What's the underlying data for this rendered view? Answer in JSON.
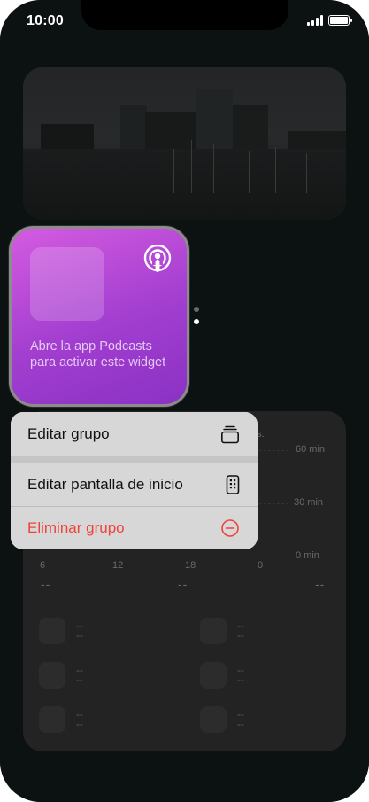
{
  "status_bar": {
    "time": "10:00"
  },
  "podcast_widget": {
    "message": "Abre la app Podcasts para activar este widget"
  },
  "screen_time": {
    "partial_label": "es.",
    "y_axis": [
      "60 min",
      "30 min",
      "0 min"
    ],
    "x_axis": [
      "6",
      "12",
      "18",
      "0"
    ],
    "totals": [
      "--",
      "--",
      "--"
    ],
    "apps": [
      {
        "name": "--",
        "time": "--"
      },
      {
        "name": "--",
        "time": "--"
      },
      {
        "name": "--",
        "time": "--"
      },
      {
        "name": "--",
        "time": "--"
      },
      {
        "name": "--",
        "time": "--"
      },
      {
        "name": "--",
        "time": "--"
      }
    ]
  },
  "context_menu": {
    "items": [
      {
        "label": "Editar grupo",
        "icon": "stack-icon"
      },
      {
        "label": "Editar pantalla de inicio",
        "icon": "phone-apps-icon"
      },
      {
        "label": "Eliminar grupo",
        "icon": "minus-circle-icon",
        "destructive": true
      }
    ]
  },
  "colors": {
    "destructive": "#f0433a",
    "podcast_purple": "#a23ed0"
  }
}
